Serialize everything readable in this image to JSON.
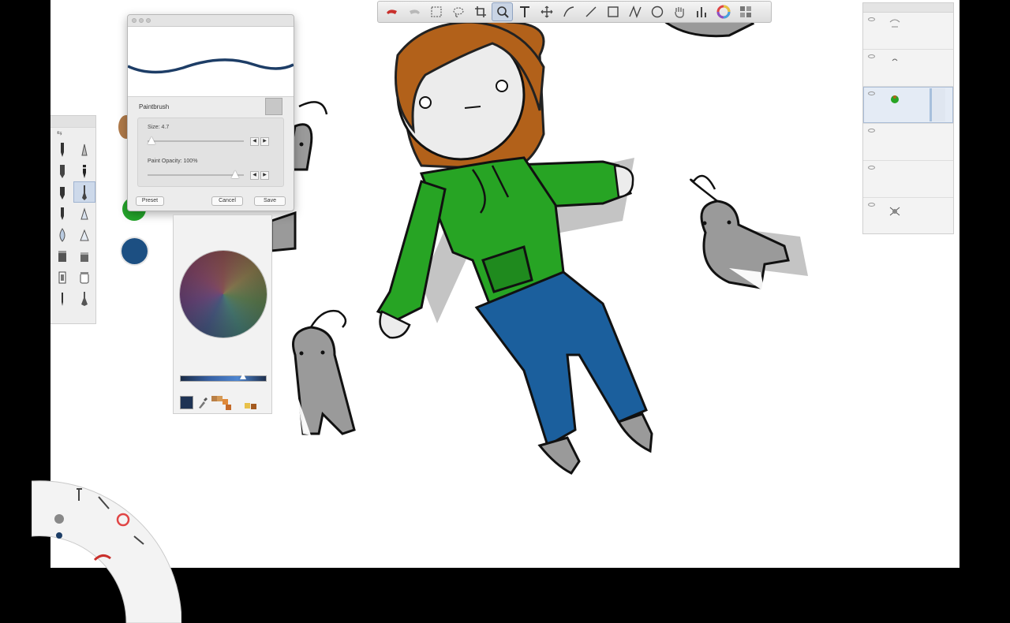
{
  "brush_dialog": {
    "brush_name": "Paintbrush",
    "size_label": "Size: 4.7",
    "size_fraction": 0.04,
    "opacity_label": "Paint Opacity: 100%",
    "opacity_fraction": 1.0,
    "buttons": {
      "preset": "Preset",
      "cancel": "Cancel",
      "save": "Save"
    },
    "stroke_color": "#1d3d66"
  },
  "colors": {
    "canvas_bg": "#ffffff",
    "hoodie": "#27a424",
    "jeans": "#1b5f9d",
    "hair": "#b2611a",
    "skin": "#ececec",
    "creature": "#9a9a9a",
    "current_color": "#1e3354",
    "recent_1": "#b07a4a",
    "recent_2": "#24a62b",
    "recent_3": "#1c4f82",
    "toolbar_active": "#c9d4e4"
  },
  "color_editor": {
    "hue_fraction": 0.72,
    "mini_swatches": [
      "#b98047",
      "#d59a56",
      "#e08a3a",
      "#c56b2a",
      "#e8c14a",
      "#a45a1f"
    ]
  },
  "toolbar": {
    "icons": [
      "undo-icon",
      "redo-icon",
      "select-rect-icon",
      "lasso-icon",
      "crop-icon",
      "zoom-icon",
      "text-icon",
      "transform-icon",
      "pen-curve-icon",
      "line-icon",
      "rectangle-icon",
      "polyline-icon",
      "ellipse-icon",
      "hand-icon",
      "brush-props-icon",
      "color-wheel-icon",
      "layers-icon"
    ]
  }
}
